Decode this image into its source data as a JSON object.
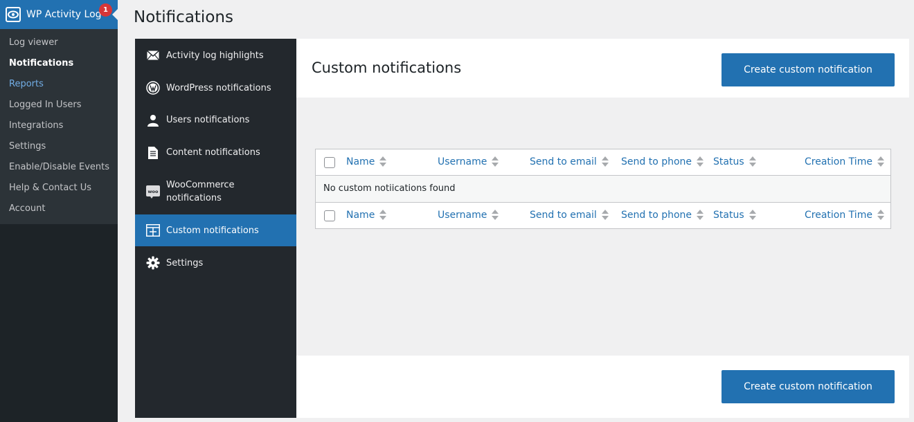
{
  "admin_menu": {
    "plugin_title": "WP Activity Log",
    "badge_count": "1",
    "items": [
      {
        "label": "Log viewer"
      },
      {
        "label": "Notifications"
      },
      {
        "label": "Reports"
      },
      {
        "label": "Logged In Users"
      },
      {
        "label": "Integrations"
      },
      {
        "label": "Settings"
      },
      {
        "label": "Enable/Disable Events"
      },
      {
        "label": "Help & Contact Us"
      },
      {
        "label": "Account"
      }
    ]
  },
  "page": {
    "title": "Notifications"
  },
  "side_nav": {
    "items": [
      {
        "label": "Activity log highlights",
        "icon": "envelope-icon"
      },
      {
        "label": "WordPress notifications",
        "icon": "wordpress-icon"
      },
      {
        "label": "Users notifications",
        "icon": "user-icon"
      },
      {
        "label": "Content notifications",
        "icon": "document-icon"
      },
      {
        "label": "WooCommerce notifications",
        "icon": "woocommerce-icon"
      },
      {
        "label": "Custom notifications",
        "icon": "custom-table-icon"
      },
      {
        "label": "Settings",
        "icon": "gear-icon"
      }
    ]
  },
  "section": {
    "heading": "Custom notifications",
    "create_button": "Create custom notification",
    "empty_message": "No custom notiications found"
  },
  "table": {
    "columns": [
      "Name",
      "Username",
      "Send to email",
      "Send to phone",
      "Status",
      "Creation Time"
    ]
  },
  "colors": {
    "accent": "#2271b1",
    "sidebar": "#1d2327",
    "panel_nav": "#23282d",
    "badge": "#d63638"
  }
}
